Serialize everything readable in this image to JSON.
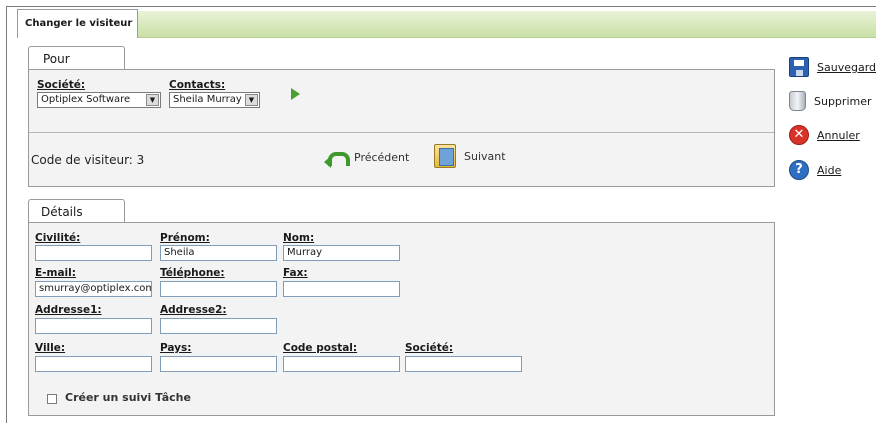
{
  "header": {
    "tab_title": "Changer le visiteur"
  },
  "pour": {
    "tab_label": "Pour",
    "societe_label": "Société:",
    "societe_value": "Optiplex Software",
    "contacts_label": "Contacts:",
    "contacts_value": "Sheila Murray",
    "code_label": "Code de visiteur: 3",
    "prev_label": "Précédent",
    "next_label": "Suivant"
  },
  "details": {
    "tab_label": "Détails",
    "civilite_label": "Civilité:",
    "civilite_value": "",
    "prenom_label": "Prénom:",
    "prenom_value": "Sheila",
    "nom_label": "Nom:",
    "nom_value": "Murray",
    "email_label": "E-mail:",
    "email_value": "smurray@optiplex.com",
    "telephone_label": "Téléphone:",
    "telephone_value": "",
    "fax_label": "Fax:",
    "fax_value": "",
    "address1_label": "Addresse1:",
    "address1_value": "",
    "address2_label": "Addresse2:",
    "address2_value": "",
    "ville_label": "Ville:",
    "ville_value": "",
    "pays_label": "Pays:",
    "pays_value": "",
    "code_postal_label": "Code postal:",
    "code_postal_value": "",
    "societe_label": "Société:",
    "societe_value": "",
    "checkbox_label": "Créer un suivi Tâche",
    "checkbox_checked": false
  },
  "actions": {
    "save_label": "Sauvegarder",
    "delete_label": "Supprimer",
    "cancel_label": "Annuler",
    "help_label": "Aide"
  },
  "icons": [
    "play-icon",
    "previous-icon",
    "next-icon",
    "save-icon",
    "trash-icon",
    "cancel-icon",
    "help-icon"
  ]
}
